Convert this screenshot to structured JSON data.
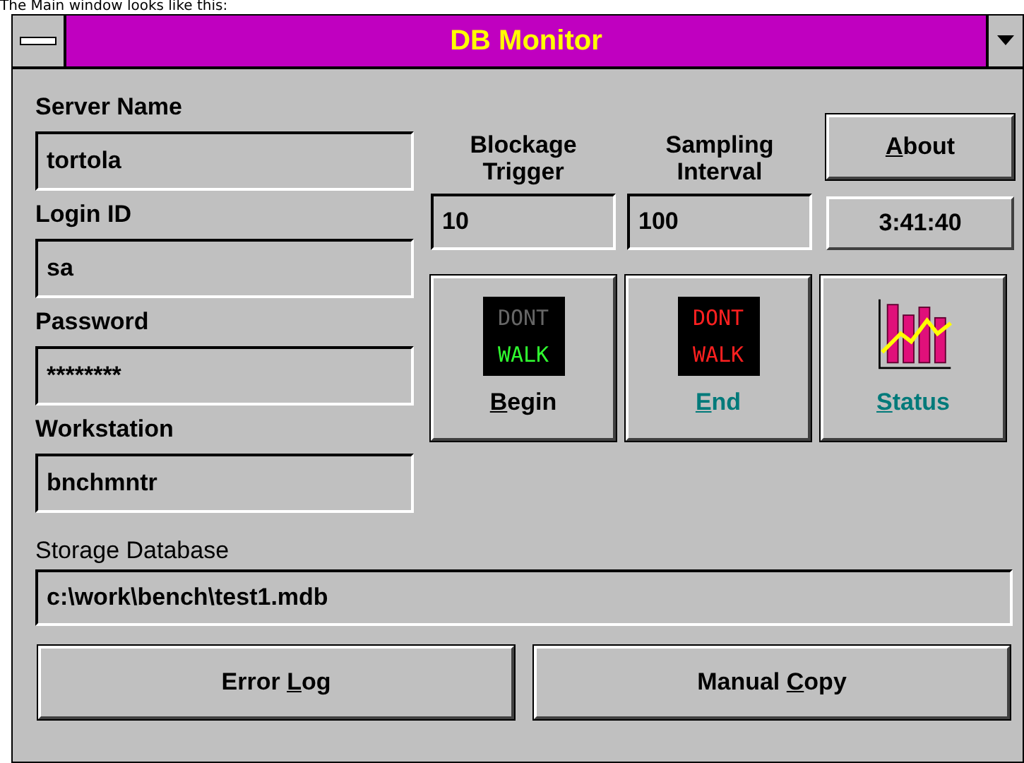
{
  "caption": "The Main window looks like this:",
  "window": {
    "title": "DB Monitor"
  },
  "left_fields": [
    {
      "label": "Server Name",
      "value": "tortola"
    },
    {
      "label": "Login ID",
      "value": "sa"
    },
    {
      "label": "Password",
      "value": "********"
    },
    {
      "label": "Workstation",
      "value": "bnchmntr"
    }
  ],
  "settings": [
    {
      "label_lines": [
        "Blockage",
        "Trigger"
      ],
      "value": "10"
    },
    {
      "label_lines": [
        "Sampling",
        "Interval"
      ],
      "value": "100"
    }
  ],
  "about_button": {
    "accelerator": "A",
    "after": "bout"
  },
  "clock": "3:41:40",
  "action_buttons": [
    {
      "kind": "walk",
      "sign": [
        "DONT",
        "WALK"
      ],
      "accelerator": "B",
      "after": "egin",
      "disabled": false
    },
    {
      "kind": "dont_walk",
      "sign": [
        "DONT",
        "WALK"
      ],
      "accelerator": "E",
      "after": "nd",
      "disabled": true
    },
    {
      "kind": "chart",
      "accelerator": "S",
      "after": "tatus",
      "disabled": true
    }
  ],
  "storage": {
    "label": "Storage Database",
    "value": "c:\\work\\bench\\test1.mdb"
  },
  "bottom_buttons": [
    {
      "before": "Error ",
      "accelerator": "L",
      "after": "og"
    },
    {
      "before": "Manual ",
      "accelerator": "C",
      "after": "opy"
    }
  ]
}
